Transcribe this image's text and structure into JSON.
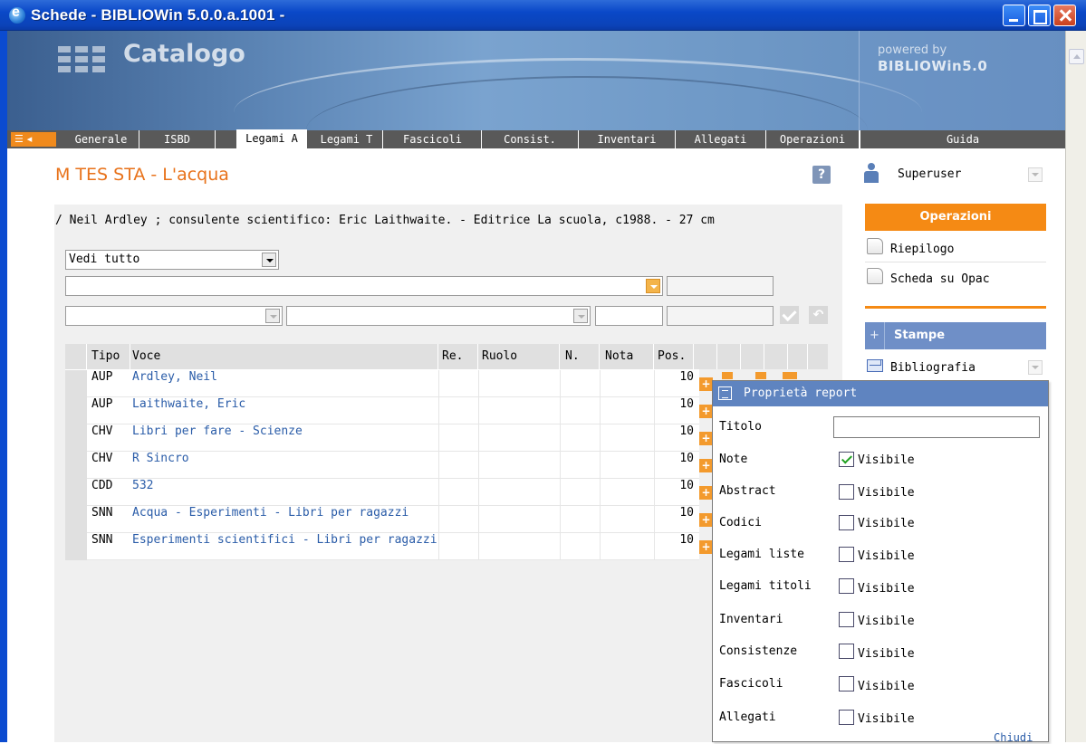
{
  "window": {
    "title": "Schede - BIBLIOWin 5.0.0.a.1001 -"
  },
  "banner": {
    "app_title": "Catalogo",
    "powered_by": "powered by",
    "brand": "BIBLIOWin5.0"
  },
  "tabs": [
    "Generale",
    "ISBD",
    "Legami A",
    "Legami T",
    "Fascicoli",
    "Consist.",
    "Inventari",
    "Allegati",
    "Operazioni"
  ],
  "active_tab": "Legami A",
  "guida": "Guida",
  "record": {
    "title": "M TES STA - L'acqua",
    "description": "/ Neil Ardley ; consulente scientifico: Eric Laithwaite. - Editrice La scuola, c1988. - 27 cm"
  },
  "filter": {
    "selected": "Vedi tutto"
  },
  "table": {
    "headers": {
      "tipo": "Tipo",
      "voce": "Voce",
      "re": "Re.",
      "ruolo": "Ruolo",
      "n": "N.",
      "nota": "Nota",
      "pos": "Pos."
    },
    "rows": [
      {
        "tipo": "AUP",
        "voce": "Ardley, Neil",
        "pos": "10"
      },
      {
        "tipo": "AUP",
        "voce": "Laithwaite, Eric",
        "pos": "10"
      },
      {
        "tipo": "CHV",
        "voce": "Libri per fare - Scienze",
        "pos": "10"
      },
      {
        "tipo": "CHV",
        "voce": "R Sincro",
        "pos": "10"
      },
      {
        "tipo": "CDD",
        "voce": "532",
        "pos": "10"
      },
      {
        "tipo": "SNN",
        "voce": "Acqua - Esperimenti - Libri per ragazzi",
        "pos": "10"
      },
      {
        "tipo": "SNN",
        "voce": "Esperimenti scientifici - Libri per ragazzi",
        "pos": "10"
      }
    ]
  },
  "sidebar": {
    "user": "Superuser",
    "operazioni": "Operazioni",
    "items": [
      "Riepilogo",
      "Scheda su Opac"
    ],
    "stampe": "Stampe",
    "stampe_plus": "+",
    "bibliografia": "Bibliografia"
  },
  "popup": {
    "title": "Proprietà report",
    "titolo_label": "Titolo",
    "titolo_value": "",
    "visible_label": "Visibile",
    "fields": [
      {
        "label": "Note",
        "checked": true
      },
      {
        "label": "Abstract",
        "checked": false
      },
      {
        "label": "Codici",
        "checked": false
      },
      {
        "label": "Legami liste",
        "checked": false
      },
      {
        "label": "Legami titoli",
        "checked": false
      },
      {
        "label": "Inventari",
        "checked": false
      },
      {
        "label": "Consistenze",
        "checked": false
      },
      {
        "label": "Fascicoli",
        "checked": false
      },
      {
        "label": "Allegati",
        "checked": false
      }
    ],
    "close": "Chiudi"
  },
  "icons": [
    "ie-icon",
    "minimize-icon",
    "maximize-icon",
    "close-icon",
    "menu-icon",
    "help-icon",
    "user-icon",
    "chevron-down-icon",
    "document-icon",
    "mail-icon",
    "plus-icon",
    "check-icon",
    "undo-icon",
    "report-icon"
  ],
  "colors": {
    "accent_orange": "#f58a14",
    "title_orange": "#e8721a",
    "blue_header": "#6f8fc7",
    "link_blue": "#2a5ca8",
    "tab_bar": "#595959"
  }
}
